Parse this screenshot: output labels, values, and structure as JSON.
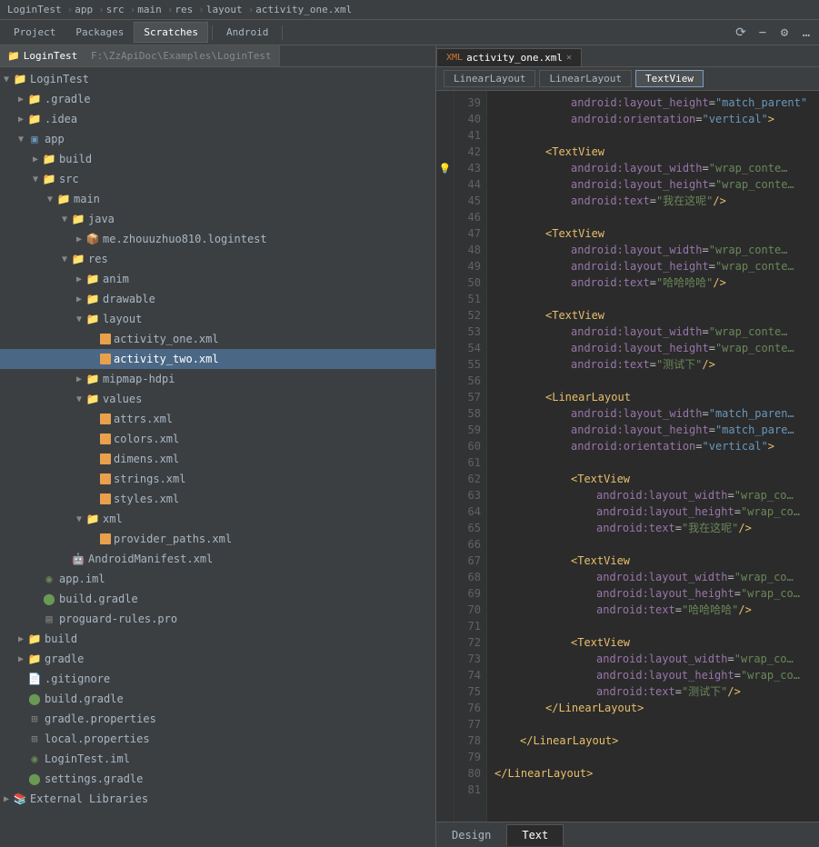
{
  "topbar": {
    "path": [
      "LoginTest",
      "app",
      "src",
      "main",
      "res",
      "layout",
      "activity_one.xml"
    ]
  },
  "toolbar": {
    "tabs": [
      {
        "label": "Project",
        "active": false
      },
      {
        "label": "Packages",
        "active": false
      },
      {
        "label": "Scratches",
        "active": false
      },
      {
        "label": "Android",
        "active": false
      }
    ]
  },
  "project_title": "LoginTest",
  "project_path": "F:\\ZzApiDoc\\Examples\\LoginTest",
  "tree": [
    {
      "id": "logintest-root",
      "label": "LoginTest",
      "level": 0,
      "type": "root",
      "expanded": true,
      "arrow": "▼"
    },
    {
      "id": "gradle",
      "label": ".gradle",
      "level": 1,
      "type": "folder",
      "expanded": false,
      "arrow": "▶"
    },
    {
      "id": "idea",
      "label": ".idea",
      "level": 1,
      "type": "folder",
      "expanded": false,
      "arrow": "▶"
    },
    {
      "id": "app",
      "label": "app",
      "level": 1,
      "type": "module",
      "expanded": true,
      "arrow": "▼"
    },
    {
      "id": "build1",
      "label": "build",
      "level": 2,
      "type": "folder",
      "expanded": false,
      "arrow": "▶"
    },
    {
      "id": "src",
      "label": "src",
      "level": 2,
      "type": "folder",
      "expanded": true,
      "arrow": "▼"
    },
    {
      "id": "main",
      "label": "main",
      "level": 3,
      "type": "folder",
      "expanded": true,
      "arrow": "▼"
    },
    {
      "id": "java",
      "label": "java",
      "level": 4,
      "type": "folder",
      "expanded": true,
      "arrow": "▼"
    },
    {
      "id": "me.zhou",
      "label": "me.zhouuzhuo810.logintest",
      "level": 5,
      "type": "package",
      "expanded": false,
      "arrow": "▶"
    },
    {
      "id": "res",
      "label": "res",
      "level": 4,
      "type": "folder",
      "expanded": true,
      "arrow": "▼"
    },
    {
      "id": "anim",
      "label": "anim",
      "level": 5,
      "type": "folder",
      "expanded": false,
      "arrow": "▶"
    },
    {
      "id": "drawable",
      "label": "drawable",
      "level": 5,
      "type": "folder",
      "expanded": false,
      "arrow": "▶"
    },
    {
      "id": "layout",
      "label": "layout",
      "level": 5,
      "type": "folder",
      "expanded": true,
      "arrow": "▼"
    },
    {
      "id": "activity_one.xml",
      "label": "activity_one.xml",
      "level": 6,
      "type": "xml",
      "expanded": false,
      "arrow": ""
    },
    {
      "id": "activity_two.xml",
      "label": "activity_two.xml",
      "level": 6,
      "type": "xml",
      "expanded": false,
      "arrow": "",
      "selected": true
    },
    {
      "id": "mipmap-hdpi",
      "label": "mipmap-hdpi",
      "level": 5,
      "type": "folder",
      "expanded": false,
      "arrow": "▶"
    },
    {
      "id": "values",
      "label": "values",
      "level": 5,
      "type": "folder",
      "expanded": true,
      "arrow": "▼"
    },
    {
      "id": "attrs.xml",
      "label": "attrs.xml",
      "level": 6,
      "type": "xml",
      "expanded": false,
      "arrow": ""
    },
    {
      "id": "colors.xml",
      "label": "colors.xml",
      "level": 6,
      "type": "xml",
      "expanded": false,
      "arrow": ""
    },
    {
      "id": "dimens.xml",
      "label": "dimens.xml",
      "level": 6,
      "type": "xml",
      "expanded": false,
      "arrow": ""
    },
    {
      "id": "strings.xml",
      "label": "strings.xml",
      "level": 6,
      "type": "xml",
      "expanded": false,
      "arrow": ""
    },
    {
      "id": "styles.xml",
      "label": "styles.xml",
      "level": 6,
      "type": "xml",
      "expanded": false,
      "arrow": ""
    },
    {
      "id": "xml-folder",
      "label": "xml",
      "level": 5,
      "type": "folder",
      "expanded": true,
      "arrow": "▼"
    },
    {
      "id": "provider_paths.xml",
      "label": "provider_paths.xml",
      "level": 6,
      "type": "xml",
      "expanded": false,
      "arrow": ""
    },
    {
      "id": "AndroidManifest.xml",
      "label": "AndroidManifest.xml",
      "level": 4,
      "type": "android-xml",
      "expanded": false,
      "arrow": ""
    },
    {
      "id": "app.iml",
      "label": "app.iml",
      "level": 2,
      "type": "iml",
      "expanded": false,
      "arrow": ""
    },
    {
      "id": "build.gradle-app",
      "label": "build.gradle",
      "level": 2,
      "type": "gradle",
      "expanded": false,
      "arrow": ""
    },
    {
      "id": "proguard-rules.pro",
      "label": "proguard-rules.pro",
      "level": 2,
      "type": "pro",
      "expanded": false,
      "arrow": ""
    },
    {
      "id": "build-root",
      "label": "build",
      "level": 1,
      "type": "folder",
      "expanded": false,
      "arrow": "▶"
    },
    {
      "id": "gradle-root",
      "label": "gradle",
      "level": 1,
      "type": "folder",
      "expanded": false,
      "arrow": "▶"
    },
    {
      "id": ".gitignore",
      "label": ".gitignore",
      "level": 1,
      "type": "file",
      "expanded": false,
      "arrow": ""
    },
    {
      "id": "build.gradle-root",
      "label": "build.gradle",
      "level": 1,
      "type": "gradle",
      "expanded": false,
      "arrow": ""
    },
    {
      "id": "gradle.properties",
      "label": "gradle.properties",
      "level": 1,
      "type": "prop",
      "expanded": false,
      "arrow": ""
    },
    {
      "id": "local.properties",
      "label": "local.properties",
      "level": 1,
      "type": "prop",
      "expanded": false,
      "arrow": ""
    },
    {
      "id": "LoginTest.iml",
      "label": "LoginTest.iml",
      "level": 1,
      "type": "iml",
      "expanded": false,
      "arrow": ""
    },
    {
      "id": "settings.gradle",
      "label": "settings.gradle",
      "level": 1,
      "type": "gradle",
      "expanded": false,
      "arrow": ""
    },
    {
      "id": "external-libraries",
      "label": "External Libraries",
      "level": 0,
      "type": "ext-lib",
      "expanded": false,
      "arrow": "▶"
    }
  ],
  "editor": {
    "active_file": "activity_one.xml",
    "layout_tabs": [
      {
        "label": "LinearLayout",
        "selected": false
      },
      {
        "label": "LinearLayout",
        "selected": false
      },
      {
        "label": "TextView",
        "selected": true
      }
    ],
    "lines": [
      {
        "num": 39,
        "gutter": "",
        "content": "<attr-value-special>android:layout_height=\"match_parent\"</attr-value-special>"
      },
      {
        "num": 40,
        "gutter": "",
        "content": "<attr-value-special>android:orientation=\"vertical\"&gt;</attr-value-special>"
      },
      {
        "num": 41,
        "gutter": "",
        "content": ""
      },
      {
        "num": 42,
        "gutter": "",
        "content": "<tag>&lt;TextView</tag>"
      },
      {
        "num": 43,
        "gutter": "bulb",
        "content": "<attr-name>android:layout_width</attr-name><attr>=</attr><attr-value>\"wrap_conte</attr-value>"
      },
      {
        "num": 44,
        "gutter": "",
        "content": "<attr-name>android:layout_height</attr-name><attr>=</attr><attr-value>\"wrap_conte</attr-value>"
      },
      {
        "num": 45,
        "gutter": "",
        "content": "<attr-name>android:text</attr-name><attr>=</attr><string-cn>\"我在这呢\"</string-cn> <tag-close>/&gt;</tag-close>"
      },
      {
        "num": 46,
        "gutter": "",
        "content": ""
      },
      {
        "num": 47,
        "gutter": "",
        "content": "<tag>&lt;TextView</tag>"
      },
      {
        "num": 48,
        "gutter": "",
        "content": "<attr-name>android:layout_width</attr-name><attr>=</attr><attr-value>\"wrap_conte</attr-value>"
      },
      {
        "num": 49,
        "gutter": "",
        "content": "<attr-name>android:layout_height</attr-name><attr>=</attr><attr-value>\"wrap_conte</attr-value>"
      },
      {
        "num": 50,
        "gutter": "",
        "content": "<attr-name>android:text</attr-name><attr>=</attr><string-cn>\"哈哈哈哈\"</string-cn> <tag-close>/&gt;</tag-close>"
      },
      {
        "num": 51,
        "gutter": "",
        "content": ""
      },
      {
        "num": 52,
        "gutter": "",
        "content": "<tag>&lt;TextView</tag>"
      },
      {
        "num": 53,
        "gutter": "",
        "content": "<attr-name>android:layout_width</attr-name><attr>=</attr><attr-value>\"wrap_conte</attr-value>"
      },
      {
        "num": 54,
        "gutter": "",
        "content": "<attr-name>android:layout_height</attr-name><attr>=</attr><attr-value>\"wrap_conte</attr-value>"
      },
      {
        "num": 55,
        "gutter": "",
        "content": "<attr-name>android:text</attr-name><attr>=</attr><string-cn>\"测试下\"</string-cn> <tag-close>/&gt;</tag-close>"
      },
      {
        "num": 56,
        "gutter": "",
        "content": ""
      },
      {
        "num": 57,
        "gutter": "",
        "content": "<tag>&lt;LinearLayout</tag>"
      },
      {
        "num": 58,
        "gutter": "",
        "content": "<attr-name>android:layout_width</attr-name><attr>=</attr><attr-value>\"match_paren</attr-value>"
      },
      {
        "num": 59,
        "gutter": "",
        "content": "<attr-name>android:layout_height</attr-name><attr>=</attr><attr-value>\"match_pare</attr-value>"
      },
      {
        "num": 60,
        "gutter": "",
        "content": "<attr-name>android:orientation</attr-name><attr>=</attr><attr-value>\"vertical\"&gt;</attr-value>"
      },
      {
        "num": 61,
        "gutter": "",
        "content": ""
      },
      {
        "num": 62,
        "gutter": "",
        "content": "<tag>&lt;TextView</tag>"
      },
      {
        "num": 63,
        "gutter": "",
        "content": "<attr-name>android:layout_width</attr-name><attr>=</attr><attr-value>\"wrap_co</attr-value>"
      },
      {
        "num": 64,
        "gutter": "",
        "content": "<attr-name>android:layout_height</attr-name><attr>=</attr><attr-value>\"wrap_co</attr-value>"
      },
      {
        "num": 65,
        "gutter": "",
        "content": "<attr-name>android:text</attr-name><attr>=</attr><string-cn>\"我在这呢\"</string-cn> <tag-close>/&gt;</tag-close>"
      },
      {
        "num": 66,
        "gutter": "",
        "content": ""
      },
      {
        "num": 67,
        "gutter": "",
        "content": "<tag>&lt;TextView</tag>"
      },
      {
        "num": 68,
        "gutter": "",
        "content": "<attr-name>android:layout_width</attr-name><attr>=</attr><attr-value>\"wrap_co</attr-value>"
      },
      {
        "num": 69,
        "gutter": "",
        "content": "<attr-name>android:layout_height</attr-name><attr>=</attr><attr-value>\"wrap_co</attr-value>"
      },
      {
        "num": 70,
        "gutter": "",
        "content": "<attr-name>android:text</attr-name><attr>=</attr><string-cn>\"哈哈哈哈\"</string-cn> <tag-close>/&gt;</tag-close>"
      },
      {
        "num": 71,
        "gutter": "",
        "content": ""
      },
      {
        "num": 72,
        "gutter": "",
        "content": "<tag>&lt;TextView</tag>"
      },
      {
        "num": 73,
        "gutter": "",
        "content": "<attr-name>android:layout_width</attr-name><attr>=</attr><attr-value>\"wrap_co</attr-value>"
      },
      {
        "num": 74,
        "gutter": "",
        "content": "<attr-name>android:layout_height</attr-name><attr>=</attr><attr-value>\"wrap_co</attr-value>"
      },
      {
        "num": 75,
        "gutter": "",
        "content": "<attr-name>android:text</attr-name><attr>=</attr><string-cn>\"测试下\"</string-cn> <tag-close>/&gt;</tag-close>"
      },
      {
        "num": 76,
        "gutter": "",
        "content": "<tag-close>&lt;/LinearLayout&gt;</tag-close>"
      },
      {
        "num": 77,
        "gutter": "",
        "content": ""
      },
      {
        "num": 78,
        "gutter": "",
        "content": "<tag-close>&lt;/LinearLayout&gt;</tag-close>"
      },
      {
        "num": 79,
        "gutter": "",
        "content": ""
      },
      {
        "num": 80,
        "gutter": "",
        "content": "<tag-close>&lt;/LinearLayout&gt;</tag-close>"
      },
      {
        "num": 81,
        "gutter": "",
        "content": ""
      }
    ]
  },
  "bottom_tabs": {
    "design_label": "Design",
    "text_label": "Text",
    "active": "Text"
  }
}
